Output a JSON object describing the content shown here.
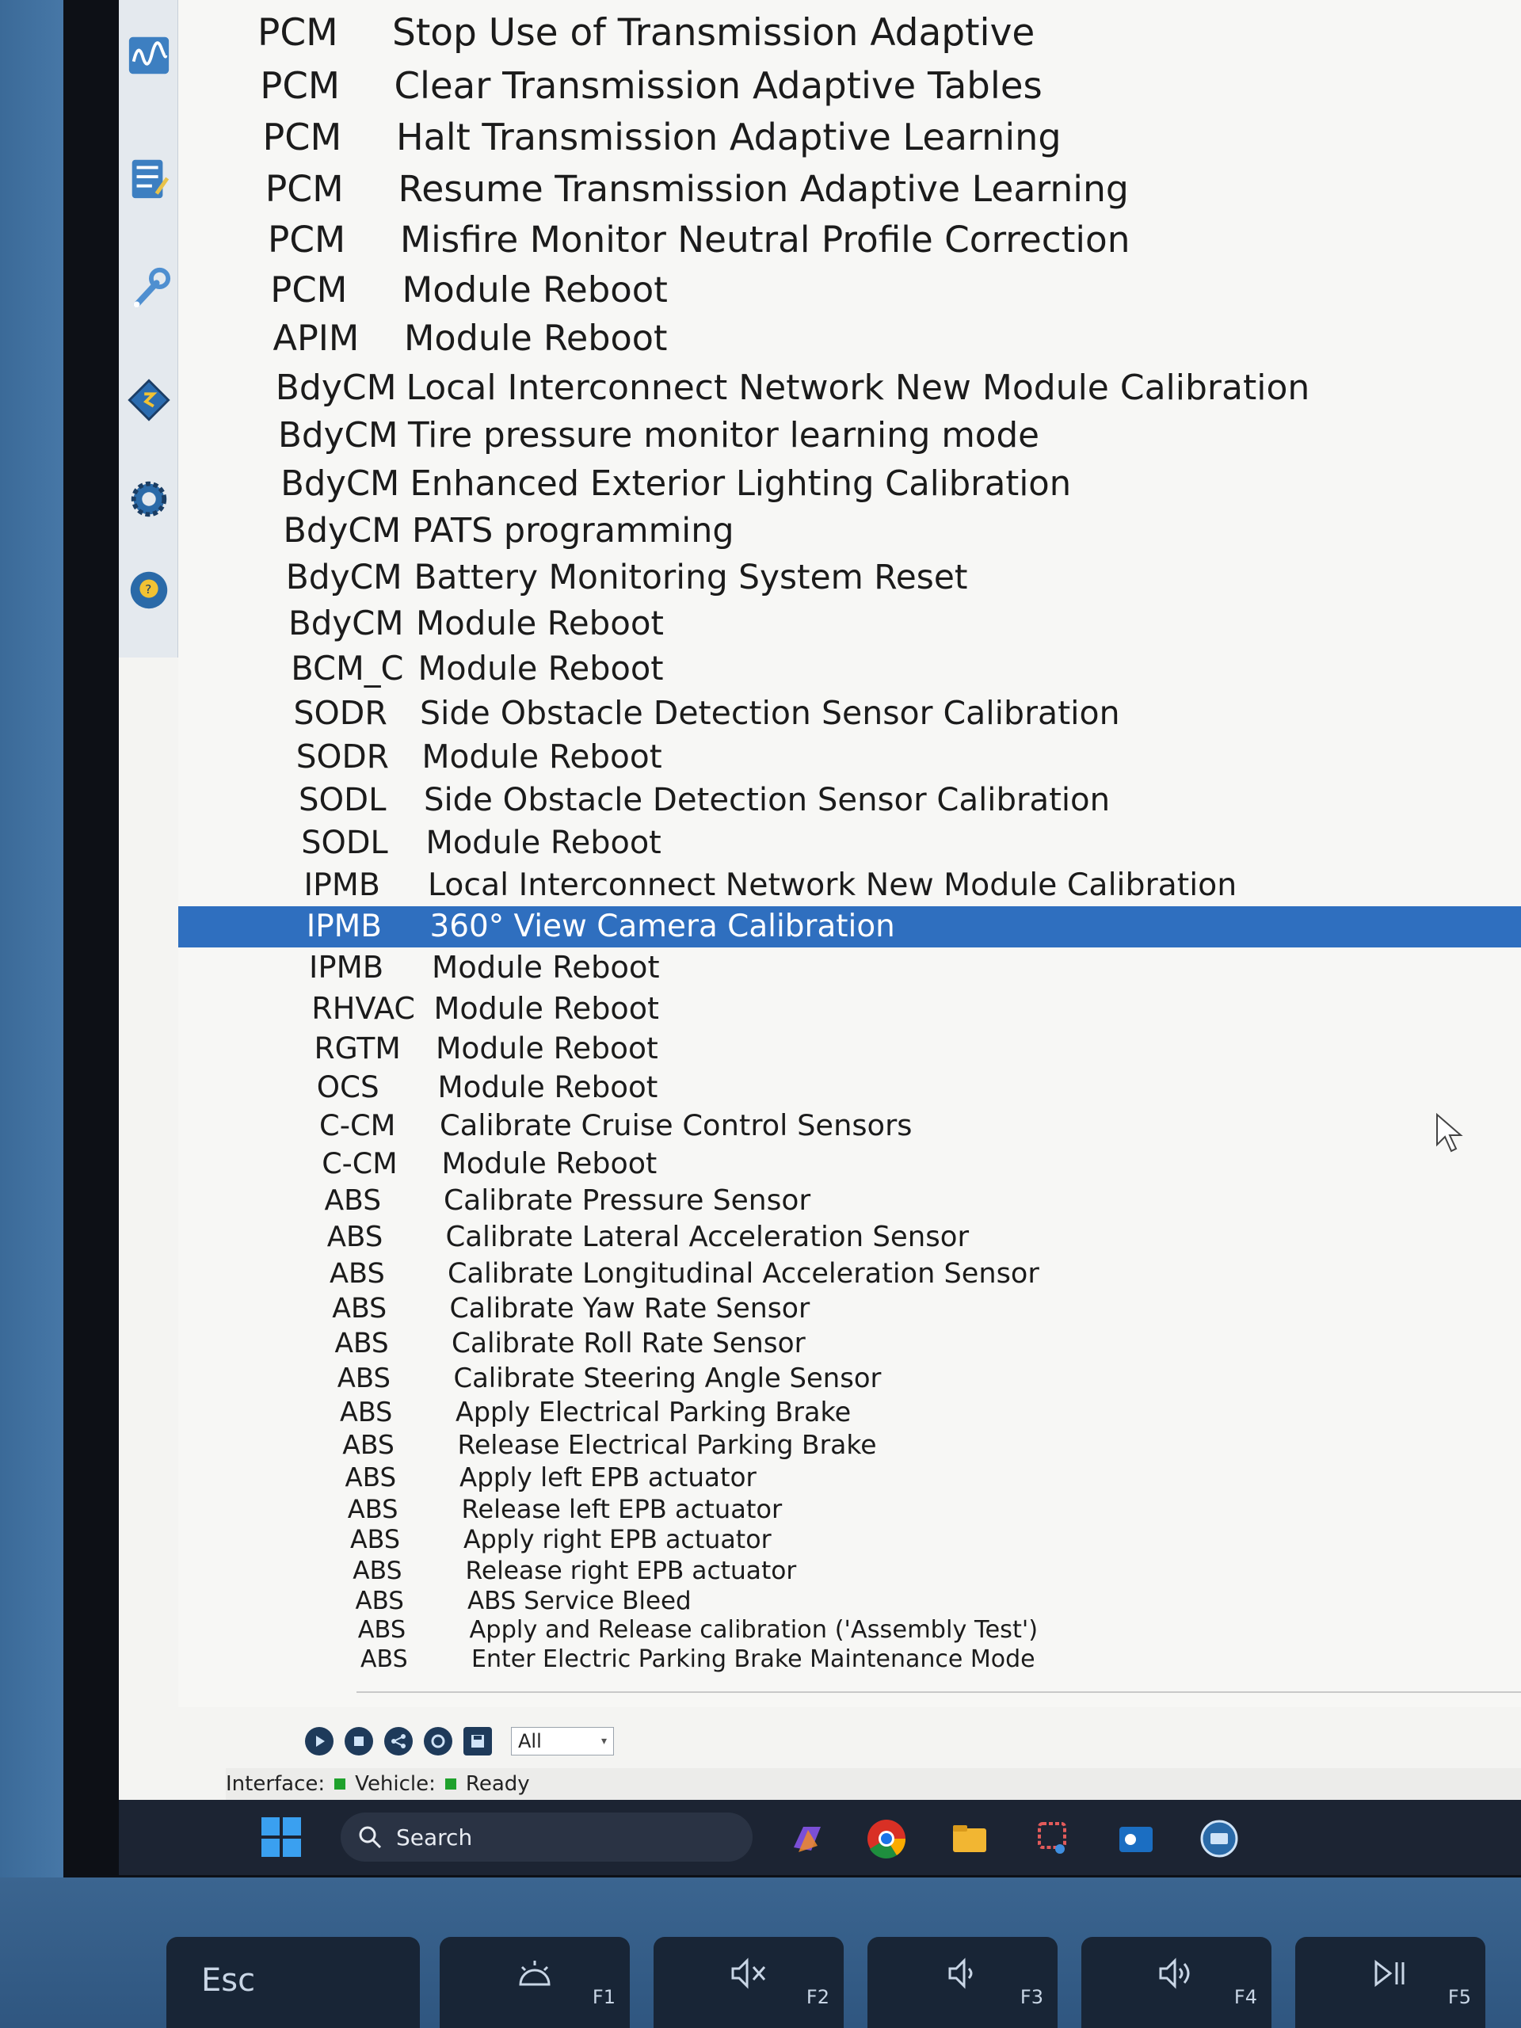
{
  "rows": [
    {
      "module": "PCM",
      "procedure": "Stop Use of Transmission Adaptive"
    },
    {
      "module": "PCM",
      "procedure": "Clear Transmission Adaptive Tables"
    },
    {
      "module": "PCM",
      "procedure": "Halt Transmission Adaptive Learning"
    },
    {
      "module": "PCM",
      "procedure": "Resume Transmission Adaptive Learning"
    },
    {
      "module": "PCM",
      "procedure": "Misfire Monitor Neutral Profile Correction"
    },
    {
      "module": "PCM",
      "procedure": "Module Reboot"
    },
    {
      "module": "APIM",
      "procedure": "Module Reboot"
    },
    {
      "module": "BdyCM",
      "procedure": "Local Interconnect Network New Module Calibration"
    },
    {
      "module": "BdyCM",
      "procedure": "Tire pressure monitor learning mode"
    },
    {
      "module": "BdyCM",
      "procedure": "Enhanced Exterior Lighting Calibration"
    },
    {
      "module": "BdyCM",
      "procedure": "PATS programming"
    },
    {
      "module": "BdyCM",
      "procedure": "Battery Monitoring System Reset"
    },
    {
      "module": "BdyCM",
      "procedure": "Module Reboot"
    },
    {
      "module": "BCM_C",
      "procedure": "Module Reboot"
    },
    {
      "module": "SODR",
      "procedure": "Side Obstacle Detection Sensor Calibration"
    },
    {
      "module": "SODR",
      "procedure": "Module Reboot"
    },
    {
      "module": "SODL",
      "procedure": "Side Obstacle Detection Sensor Calibration"
    },
    {
      "module": "SODL",
      "procedure": "Module Reboot"
    },
    {
      "module": "IPMB",
      "procedure": "Local Interconnect Network New Module Calibration"
    },
    {
      "module": "IPMB",
      "procedure": "360° View Camera Calibration"
    },
    {
      "module": "IPMB",
      "procedure": "Module Reboot"
    },
    {
      "module": "RHVAC",
      "procedure": "Module Reboot"
    },
    {
      "module": "RGTM",
      "procedure": "Module Reboot"
    },
    {
      "module": "OCS",
      "procedure": "Module Reboot"
    },
    {
      "module": "C-CM",
      "procedure": "Calibrate Cruise Control Sensors"
    },
    {
      "module": "C-CM",
      "procedure": "Module Reboot"
    },
    {
      "module": "ABS",
      "procedure": "Calibrate Pressure Sensor"
    },
    {
      "module": "ABS",
      "procedure": "Calibrate Lateral Acceleration Sensor"
    },
    {
      "module": "ABS",
      "procedure": "Calibrate Longitudinal Acceleration Sensor"
    },
    {
      "module": "ABS",
      "procedure": "Calibrate Yaw Rate Sensor"
    },
    {
      "module": "ABS",
      "procedure": "Calibrate Roll Rate Sensor"
    },
    {
      "module": "ABS",
      "procedure": "Calibrate Steering Angle Sensor"
    },
    {
      "module": "ABS",
      "procedure": "Apply Electrical Parking Brake"
    },
    {
      "module": "ABS",
      "procedure": "Release Electrical Parking Brake"
    },
    {
      "module": "ABS",
      "procedure": "Apply left EPB actuator"
    },
    {
      "module": "ABS",
      "procedure": "Release left EPB actuator"
    },
    {
      "module": "ABS",
      "procedure": "Apply right EPB actuator"
    },
    {
      "module": "ABS",
      "procedure": "Release right EPB actuator"
    },
    {
      "module": "ABS",
      "procedure": "ABS Service Bleed"
    },
    {
      "module": "ABS",
      "procedure": "Apply and Release calibration ('Assembly Test')"
    },
    {
      "module": "ABS",
      "procedure": "Enter Electric Parking Brake Maintenance Mode"
    }
  ],
  "selected_index": 19,
  "filter": {
    "value": "All"
  },
  "status": {
    "interface_label": "Interface:",
    "vehicle_label": "Vehicle:",
    "state": "Ready"
  },
  "taskbar": {
    "search_placeholder": "Search"
  },
  "keyboard": {
    "esc": "Esc",
    "f1": "F1",
    "f2": "F2",
    "f3": "F3",
    "f4": "F4",
    "f5": "F5"
  },
  "colors": {
    "selection": "#2f6fbf",
    "status_led": "#1fa12c",
    "taskbar": "#1c2433"
  },
  "icons": {
    "toolbar": [
      "waveform-icon",
      "checklist-icon",
      "wrench-icon",
      "module-program-icon",
      "settings-gear-icon",
      "help-icon"
    ],
    "controls": [
      "run-icon",
      "stop-icon",
      "network-icon",
      "refresh-icon",
      "save-icon"
    ]
  }
}
